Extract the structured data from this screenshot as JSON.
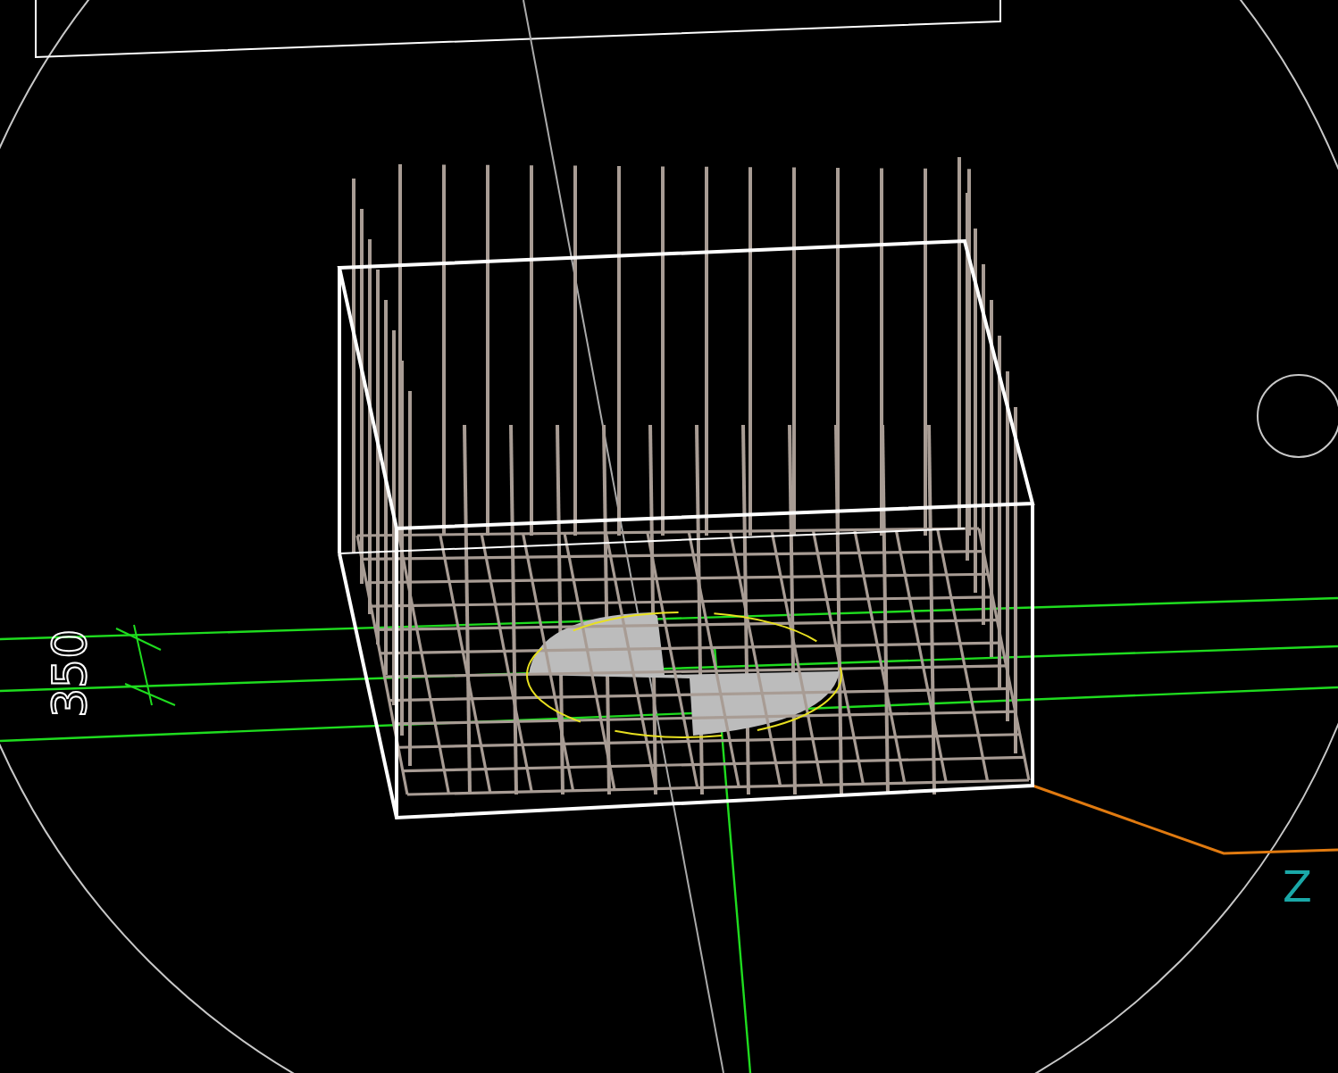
{
  "dimension": {
    "text": "350"
  },
  "axis_label": {
    "text": "Z"
  }
}
